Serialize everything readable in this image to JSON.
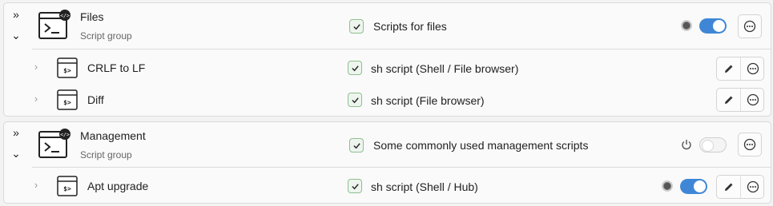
{
  "groups": [
    {
      "title": "Files",
      "subtitle": "Script group",
      "description": "Scripts for files",
      "enabled": true,
      "scripts": [
        {
          "name": "CRLF to LF",
          "description": "sh script (Shell / File browser)"
        },
        {
          "name": "Diff",
          "description": "sh script (File browser)"
        }
      ]
    },
    {
      "title": "Management",
      "subtitle": "Script group",
      "description": "Some commonly used management scripts",
      "enabled": false,
      "scripts": [
        {
          "name": "Apt upgrade",
          "description": "sh script (Shell / Hub)",
          "enabled": true
        }
      ]
    }
  ],
  "icons": {
    "expand_all": "double-chevron-right-icon",
    "collapse": "chevron-down-icon",
    "row_expand": "chevron-right-icon",
    "group": "terminal-code-icon",
    "script": "shell-script-icon",
    "edit": "pencil-icon",
    "more": "more-horizontal-icon",
    "power": "power-icon",
    "check": "check-icon"
  },
  "colors": {
    "accent": "#3f87d6",
    "checkbox_border": "#8fbf8f"
  }
}
